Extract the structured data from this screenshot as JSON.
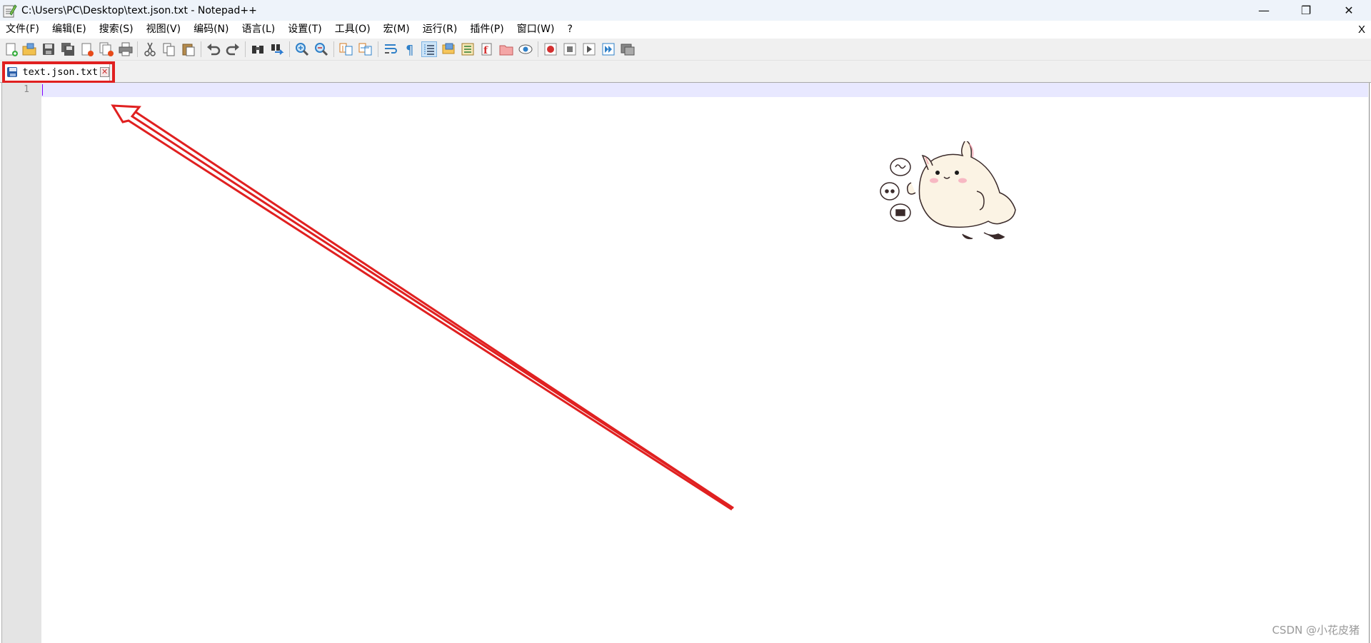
{
  "window": {
    "title": "C:\\Users\\PC\\Desktop\\text.json.txt - Notepad++",
    "minimize_glyph": "—",
    "restore_glyph": "❐",
    "close_glyph": "✕"
  },
  "menu": {
    "items": [
      "文件(F)",
      "编辑(E)",
      "搜索(S)",
      "视图(V)",
      "编码(N)",
      "语言(L)",
      "设置(T)",
      "工具(O)",
      "宏(M)",
      "运行(R)",
      "插件(P)",
      "窗口(W)",
      "?"
    ],
    "close_doc": "X"
  },
  "toolbar": {
    "icons": [
      "new-file-icon",
      "open-file-icon",
      "save-icon",
      "save-all-icon",
      "close-icon",
      "close-all-icon",
      "print-icon",
      "cut-icon",
      "copy-icon",
      "paste-icon",
      "undo-icon",
      "redo-icon",
      "find-icon",
      "replace-icon",
      "zoom-in-icon",
      "zoom-out-icon",
      "sync-vertical-icon",
      "sync-horizontal-icon",
      "word-wrap-icon",
      "show-all-chars-icon",
      "indent-guide-icon",
      "document-map-icon",
      "function-list-icon",
      "folder-as-workspace-icon",
      "monitoring-icon",
      "record-macro-icon",
      "stop-recording-icon",
      "play-macro-icon",
      "run-macro-multiple-icon",
      "save-macro-icon"
    ]
  },
  "tabs": [
    {
      "label": "text.json.txt",
      "close": "✕"
    }
  ],
  "editor": {
    "line_numbers": [
      "1"
    ],
    "content": ""
  },
  "annotation": {
    "color": "#e02020"
  },
  "watermark": "CSDN @小花皮猪",
  "colors": {
    "titlebar_bg": "#eef3fa",
    "current_line": "#e8e8ff",
    "gutter": "#e4e4e4",
    "annotation_red": "#e02020"
  }
}
